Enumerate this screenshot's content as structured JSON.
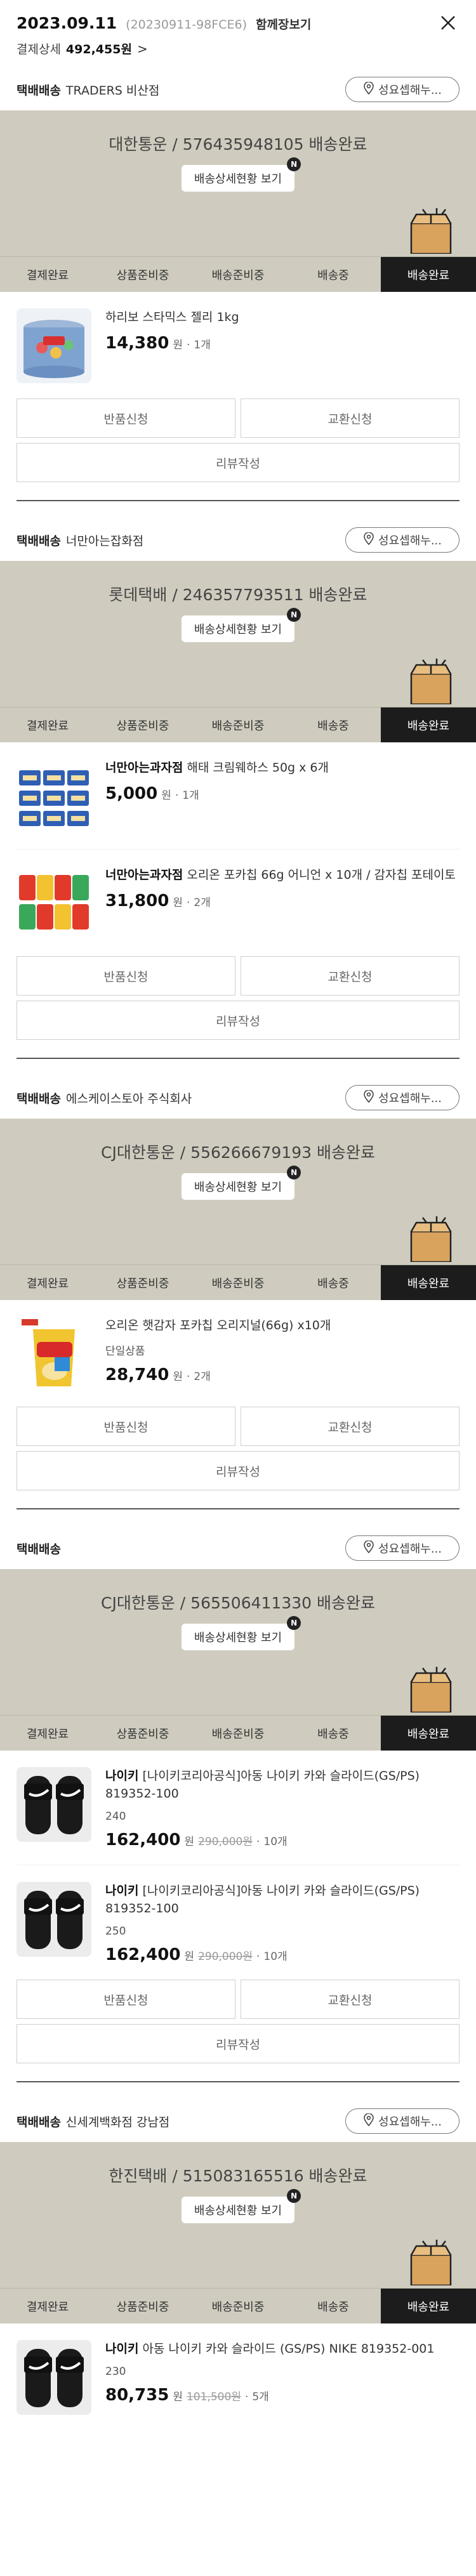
{
  "header": {
    "date": "2023.09.11",
    "order_no": "(20230911-98FCE6)",
    "merged": "함께장보기",
    "summary_label": "결제상세",
    "summary_value": "492,455원",
    "summary_chevron": ">"
  },
  "labels": {
    "detail_button": "배송상세현황 보기",
    "new_badge": "N",
    "store_button": "성요셉해누...",
    "return": "반품신청",
    "exchange": "교환신청",
    "review": "리뷰작성",
    "price_unit": "원",
    "sep": "·"
  },
  "steps": [
    "결제완료",
    "상품준비중",
    "배송준비중",
    "배송중",
    "배송완료"
  ],
  "sections": [
    {
      "type": "택배배송",
      "seller": "TRADERS 비산점",
      "banner": "대한통운 / 576435948105 배송완료",
      "items": [
        {
          "brand": "",
          "name": "하리보 스타믹스 젤리 1kg",
          "option": "",
          "price": "14,380",
          "orig": "",
          "qty": "1개"
        }
      ],
      "actions": true
    },
    {
      "type": "택배배송",
      "seller": "너만아는잡화점",
      "banner": "롯데택배 / 246357793511 배송완료",
      "items": [
        {
          "brand": "너만아는과자점",
          "name": "해태 크림웨하스 50g x 6개",
          "option": "",
          "price": "5,000",
          "orig": "",
          "qty": "1개"
        },
        {
          "brand": "너만아는과자점",
          "name": "오리온 포카칩 66g 어니언 x 10개 / 감자칩 포테이토",
          "option": "",
          "price": "31,800",
          "orig": "",
          "qty": "2개"
        }
      ],
      "actions": true
    },
    {
      "type": "택배배송",
      "seller": "에스케이스토아 주식회사",
      "banner": "CJ대한통운 / 556266679193 배송완료",
      "items": [
        {
          "brand": "",
          "name": "오리온 햇감자 포카칩 오리지널(66g) x10개",
          "option": "단일상품",
          "price": "28,740",
          "orig": "",
          "qty": "2개"
        }
      ],
      "actions": true
    },
    {
      "type": "택배배송",
      "seller": "",
      "banner": "CJ대한통운 / 565506411330 배송완료",
      "items": [
        {
          "brand": "나이키",
          "name": "[나이키코리아공식]아동 나이키 카와 슬라이드(GS/PS) 819352-100",
          "option": "240",
          "price": "162,400",
          "orig": "290,000원",
          "qty": "10개"
        },
        {
          "brand": "나이키",
          "name": "[나이키코리아공식]아동 나이키 카와 슬라이드(GS/PS) 819352-100",
          "option": "250",
          "price": "162,400",
          "orig": "290,000원",
          "qty": "10개"
        }
      ],
      "actions": true
    },
    {
      "type": "택배배송",
      "seller": "신세계백화점 강남점",
      "banner": "한진택배 / 515083165516 배송완료",
      "items": [
        {
          "brand": "나이키",
          "name": "아동 나이키 카와 슬라이드 (GS/PS) NIKE 819352-001",
          "option": "230",
          "price": "80,735",
          "orig": "101,500원",
          "qty": "5개"
        }
      ],
      "actions": false
    }
  ]
}
